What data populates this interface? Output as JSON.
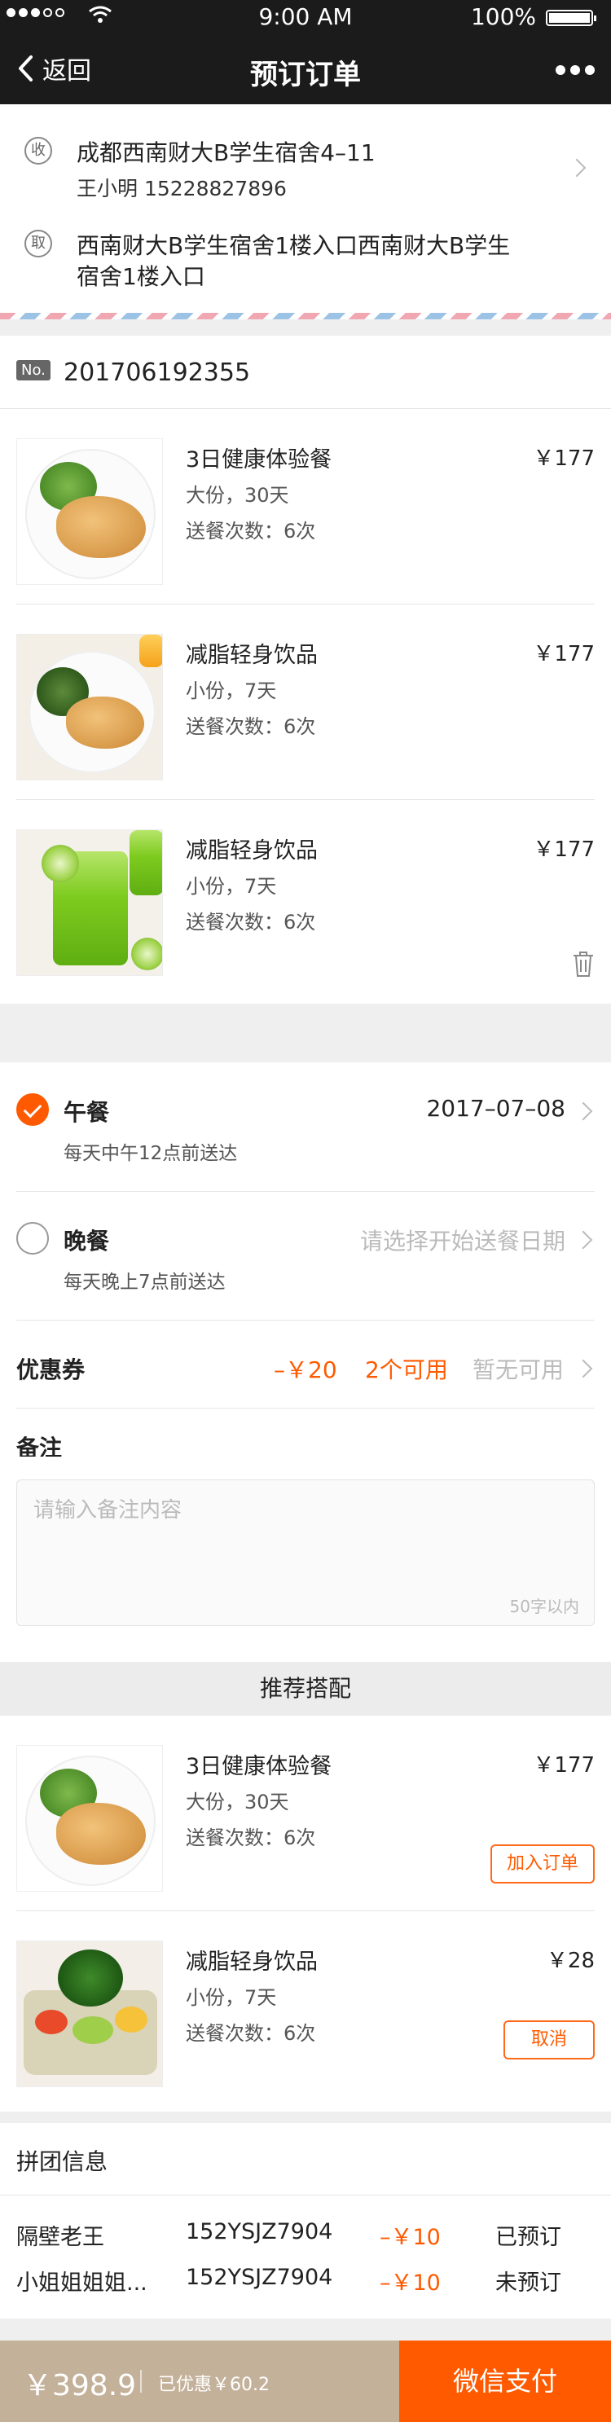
{
  "status_bar": {
    "time": "9:00 AM",
    "battery": "100%"
  },
  "nav": {
    "back_label": "返回",
    "title": "预订订单"
  },
  "address": {
    "receive_tag": "收",
    "receive_address": "成都西南财大B学生宿舍4–11",
    "receiver": "王小明  15228827896",
    "pickup_tag": "取",
    "pickup_line1": "西南财大B学生宿舍1楼入口西南财大B学生",
    "pickup_line2": "宿舍1楼入口"
  },
  "order": {
    "no_label": "No.",
    "number": "201706192355"
  },
  "products": [
    {
      "name": "3日健康体验餐",
      "spec": "大份，30天",
      "times": "送餐次数：6次",
      "price": "￥177",
      "image": "chicken-salad-plate"
    },
    {
      "name": "减脂轻身饮品",
      "spec": "小份，7天",
      "times": "送餐次数：6次",
      "price": "￥177",
      "image": "chicken-salad-plate-2"
    },
    {
      "name": "减脂轻身饮品",
      "spec": "小份，7天",
      "times": "送餐次数：6次",
      "price": "￥177",
      "image": "cucumber-juice"
    }
  ],
  "meals": [
    {
      "name": "午餐",
      "desc": "每天中午12点前送达",
      "date": "2017–07–08",
      "checked": true
    },
    {
      "name": "晚餐",
      "desc": "每天晚上7点前送达",
      "date": "请选择开始送餐日期",
      "checked": false
    }
  ],
  "coupon": {
    "label": "优惠券",
    "amount": "–￥20",
    "available": "2个可用",
    "none": "暂无可用"
  },
  "remark": {
    "label": "备注",
    "placeholder": "请输入备注内容",
    "limit": "50字以内"
  },
  "recommend": {
    "title": "推荐搭配",
    "items": [
      {
        "name": "3日健康体验餐",
        "spec": "大份，30天",
        "times": "送餐次数：6次",
        "price": "￥177",
        "action": "加入订单"
      },
      {
        "name": "减脂轻身饮品",
        "spec": "小份，7天",
        "times": "送餐次数：6次",
        "price": "￥28",
        "action": "取消"
      }
    ]
  },
  "group": {
    "title": "拼团信息",
    "members": [
      {
        "name": "隔壁老王",
        "code": "152YSJZ7904",
        "discount": "–￥10",
        "status": "已预订"
      },
      {
        "name": "小姐姐姐姐...",
        "code": "152YSJZ7904",
        "discount": "–￥10",
        "status": "未预订"
      }
    ]
  },
  "bottom": {
    "total": "￥398.9",
    "discount": "已优惠￥60.2",
    "pay": "微信支付"
  },
  "colors": {
    "accent": "#ff5a00",
    "nav_bg": "#1b1b1b",
    "bottom_left_bg": "#c4b19a"
  }
}
